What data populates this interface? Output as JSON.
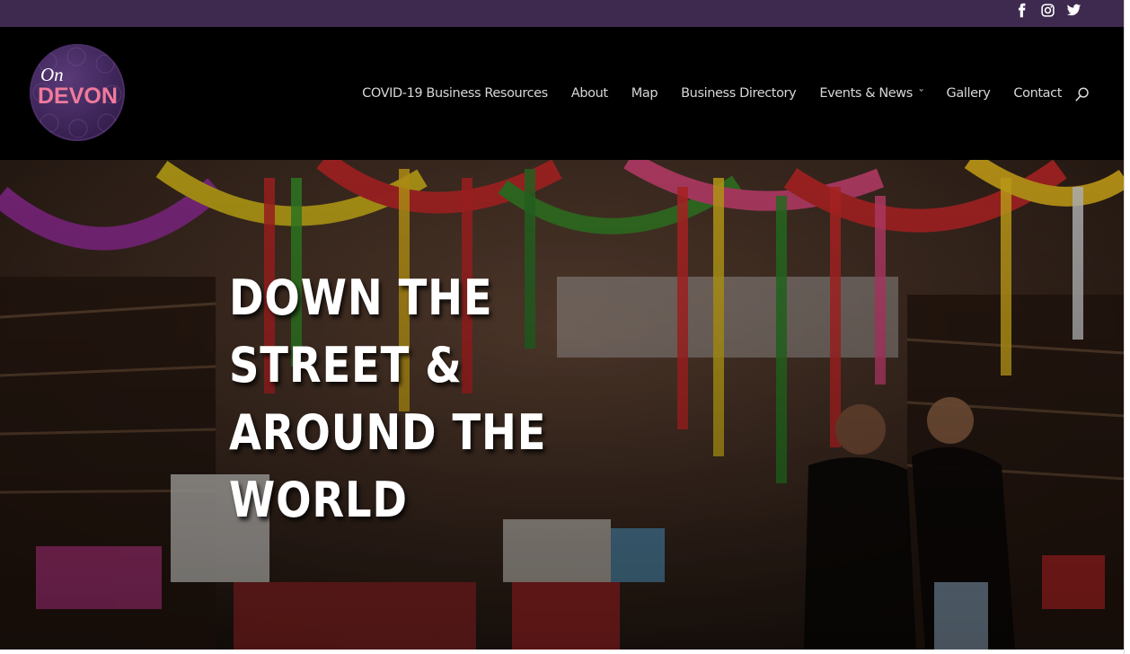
{
  "social": {
    "icons": [
      "facebook-icon",
      "instagram-icon",
      "twitter-icon"
    ]
  },
  "logo": {
    "line1": "On",
    "line2": "DEVON"
  },
  "nav": {
    "items": [
      {
        "label": "COVID-19 Business Resources"
      },
      {
        "label": "About"
      },
      {
        "label": "Map"
      },
      {
        "label": "Business Directory"
      },
      {
        "label": "Events & News",
        "has_dropdown": true
      },
      {
        "label": "Gallery"
      },
      {
        "label": "Contact"
      }
    ],
    "search_icon": "search-icon"
  },
  "hero": {
    "lines": [
      "DOWN THE",
      "STREET &",
      "AROUND THE",
      "WORLD"
    ]
  },
  "colors": {
    "topbar": "#3d2a4e",
    "header": "#000000",
    "nav_text": "#d7d7d7",
    "logo_accent": "#f07a9b"
  }
}
